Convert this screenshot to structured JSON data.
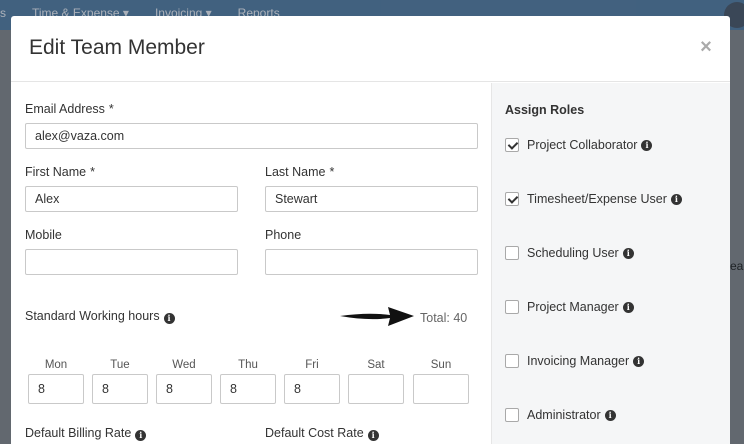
{
  "background": {
    "nav_items": [
      "s",
      "Time & Expense ▾",
      "Invoicing ▾",
      "Reports"
    ],
    "edge_text": "ear"
  },
  "modal": {
    "title": "Edit Team Member",
    "close_label": "×"
  },
  "form": {
    "email": {
      "label": "Email Address",
      "required_mark": "*",
      "value": "alex@vaza.com"
    },
    "first_name": {
      "label": "First Name",
      "required_mark": "*",
      "value": "Alex"
    },
    "last_name": {
      "label": "Last Name",
      "required_mark": "*",
      "value": "Stewart"
    },
    "mobile": {
      "label": "Mobile",
      "value": ""
    },
    "phone": {
      "label": "Phone",
      "value": ""
    },
    "working_hours": {
      "label": "Standard Working hours",
      "total": "Total: 40",
      "days": [
        {
          "label": "Mon",
          "value": "8"
        },
        {
          "label": "Tue",
          "value": "8"
        },
        {
          "label": "Wed",
          "value": "8"
        },
        {
          "label": "Thu",
          "value": "8"
        },
        {
          "label": "Fri",
          "value": "8"
        },
        {
          "label": "Sat",
          "value": ""
        },
        {
          "label": "Sun",
          "value": ""
        }
      ]
    },
    "default_billing_rate": {
      "label": "Default Billing Rate"
    },
    "default_cost_rate": {
      "label": "Default Cost Rate"
    }
  },
  "roles": {
    "title": "Assign Roles",
    "items": [
      {
        "label": "Project Collaborator",
        "checked": true
      },
      {
        "label": "Timesheet/Expense User",
        "checked": true
      },
      {
        "label": "Scheduling User",
        "checked": false
      },
      {
        "label": "Project Manager",
        "checked": false
      },
      {
        "label": "Invoicing Manager",
        "checked": false
      },
      {
        "label": "Administrator",
        "checked": false
      }
    ]
  },
  "icons": {
    "info": "info-icon",
    "close": "close-icon",
    "arrow": "arrow-right-icon",
    "check": "check-icon"
  },
  "colors": {
    "nav": "#2a5d8c",
    "overlay": "#62686f",
    "panel": "#f5f6f7"
  }
}
